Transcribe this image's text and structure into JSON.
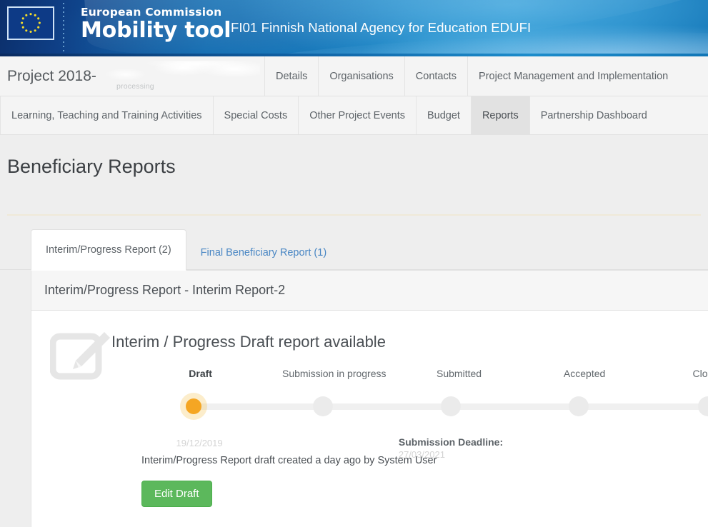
{
  "banner": {
    "flag_alt": "eu-flag",
    "brand_line1": "European Commission",
    "brand_line2": "Mobility tool",
    "agency": "FI01 Finnish National Agency for Education EDUFI"
  },
  "nav": {
    "project_title": "Project 2018-",
    "project_code_redacted": "",
    "processing_label": "processing",
    "row1": [
      {
        "label": "Details",
        "active": false
      },
      {
        "label": "Organisations",
        "active": false
      },
      {
        "label": "Contacts",
        "active": false
      },
      {
        "label": "Project Management and Implementation",
        "active": false
      }
    ],
    "row2": [
      {
        "label": "Learning, Teaching and Training Activities",
        "active": false
      },
      {
        "label": "Special Costs",
        "active": false
      },
      {
        "label": "Other Project Events",
        "active": false
      },
      {
        "label": "Budget",
        "active": false
      },
      {
        "label": "Reports",
        "active": true
      },
      {
        "label": "Partnership Dashboard",
        "active": false
      }
    ]
  },
  "page": {
    "title": "Beneficiary Reports"
  },
  "tabs": [
    {
      "label": "Interim/Progress Report (2)",
      "active": true
    },
    {
      "label": "Final Beneficiary Report (1)",
      "active": false
    }
  ],
  "report": {
    "panel_heading": "Interim/Progress Report - Interim Report-2",
    "state_heading": "Interim / Progress Draft report available",
    "created_text": "Interim/Progress Report draft created a day ago by System User",
    "edit_button": "Edit Draft",
    "draft_date_redacted": "19/12/2019",
    "deadline_label": "Submission Deadline:",
    "deadline_date_redacted": "27/03/2021",
    "steps": [
      {
        "label": "Draft",
        "current": true
      },
      {
        "label": "Submission in progress",
        "current": false
      },
      {
        "label": "Submitted",
        "current": false
      },
      {
        "label": "Accepted",
        "current": false
      },
      {
        "label": "Closed",
        "current": false
      }
    ]
  },
  "colors": {
    "accent_green": "#5cb85c",
    "accent_amber": "#f5a623",
    "link_blue": "#4a87c4",
    "banner_blue": "#1683c4"
  }
}
